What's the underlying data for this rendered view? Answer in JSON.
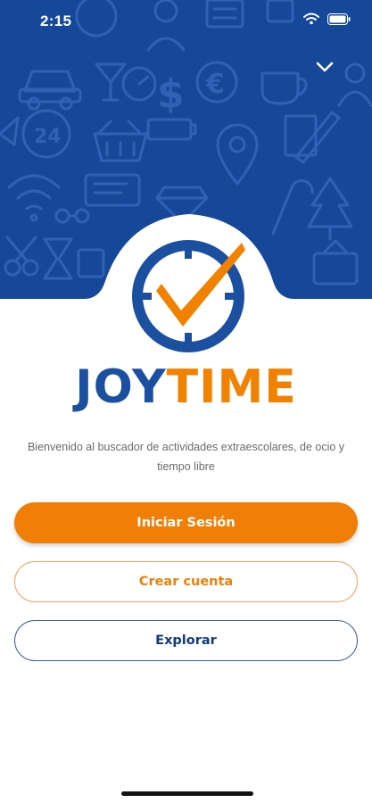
{
  "status_bar": {
    "time": "2:15",
    "icons": [
      "wifi-icon",
      "battery-icon"
    ]
  },
  "header": {
    "collapse_icon": "chevron-down-icon"
  },
  "logo": {
    "part1": "JOY",
    "part2": "TIME",
    "colors": {
      "joy": "#1b4fa0",
      "time": "#f08200"
    }
  },
  "welcome_text": "Bienvenido al buscador de actividades extraescolares, de ocio y tiempo libre",
  "buttons": {
    "login": "Iniciar Sesión",
    "register": "Crear cuenta",
    "explore": "Explorar"
  },
  "colors": {
    "brand_blue": "#16489a",
    "brand_orange": "#f07f08"
  }
}
